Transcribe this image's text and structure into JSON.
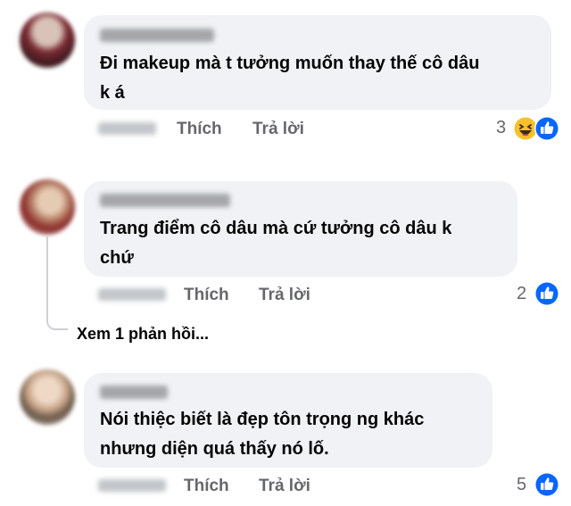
{
  "comments": [
    {
      "text": "Đi makeup mà t tưởng muốn thay thế cô dâu\nk á",
      "like_label": "Thích",
      "reply_label": "Trả lời",
      "reaction_count": "3",
      "reactions": [
        "haha-icon",
        "like-icon"
      ]
    },
    {
      "text": "Trang điểm cô dâu mà cứ tưởng cô dâu k\nchứ",
      "like_label": "Thích",
      "reply_label": "Trả lời",
      "reaction_count": "2",
      "reactions": [
        "like-icon"
      ],
      "see_replies": "Xem 1 phản hồi..."
    },
    {
      "text": "Nói thiệc biết là đẹp tôn trọng ng khác\nnhưng diện quá thấy nó lố.",
      "like_label": "Thích",
      "reply_label": "Trả lời",
      "reaction_count": "5",
      "reactions": [
        "like-icon"
      ]
    }
  ],
  "colors": {
    "bubble": "#f0f2f5",
    "secondary_text": "#65676b",
    "like_blue": "#0866ff"
  }
}
